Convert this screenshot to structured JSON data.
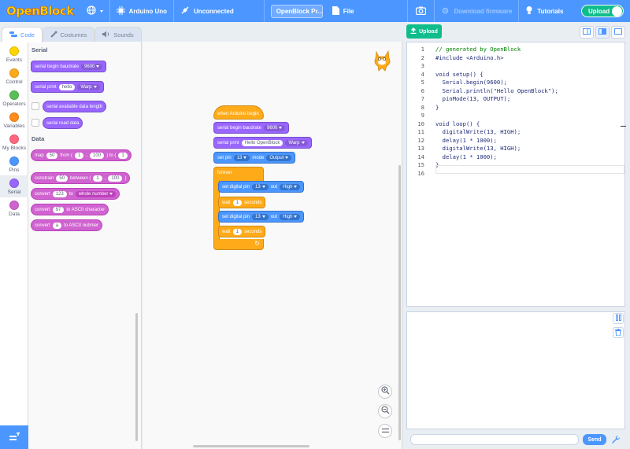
{
  "menubar": {
    "logo": "OpenBlock",
    "board": "Arduino Uno",
    "connection": "Unconnected",
    "project_name": "OpenBlock Pr...",
    "file": "File",
    "download_firmware": "Download firmware",
    "tutorials": "Tutorials",
    "mode_toggle": "Upload"
  },
  "tabs": {
    "code": "Code",
    "costumes": "Costumes",
    "sounds": "Sounds"
  },
  "categories": [
    {
      "label": "Events",
      "color": "#ffd500"
    },
    {
      "label": "Control",
      "color": "#ffab19"
    },
    {
      "label": "Operators",
      "color": "#59c059"
    },
    {
      "label": "Variables",
      "color": "#ff8c1a"
    },
    {
      "label": "My Blocks",
      "color": "#ff6680"
    },
    {
      "label": "Pins",
      "color": "#4c97ff"
    },
    {
      "label": "Serial",
      "color": "#9966ff"
    },
    {
      "label": "Data",
      "color": "#cf63cf"
    }
  ],
  "palette": {
    "serial_heading": "Serial",
    "begin": {
      "text": "serial begin baudrate",
      "value": "9600"
    },
    "print": {
      "text": "serial print",
      "value": "hello",
      "mode": "Warp"
    },
    "available": "serial available data length",
    "read": "serial read data",
    "data_heading": "Data",
    "map": {
      "text": "map",
      "v1": "50",
      "from": "from (",
      "v2": "1",
      "comma": ",",
      "v3": "100",
      "to": ") to (",
      "v4": "1"
    },
    "constrain": {
      "text": "constrain",
      "v1": "50",
      "between": "between (",
      "v2": "1",
      "comma": ",",
      "v3": "100",
      "close": ")"
    },
    "convert": {
      "text": "convert",
      "v1": "123",
      "to": "to",
      "type": "whole number"
    },
    "convert_char": {
      "text": "convert",
      "v1": "97",
      "suffix": "to ASCII character"
    },
    "convert_num": {
      "text": "convert",
      "v1": "a",
      "suffix": "to ASCII nubmer"
    }
  },
  "script": {
    "hat": "when Arduino begin",
    "begin": {
      "text": "serial begin baudrate",
      "value": "9600"
    },
    "print": {
      "text": "serial print",
      "value": "Hello OpenBlock",
      "mode": "Warp"
    },
    "setpin": {
      "text": "set pin",
      "pin": "13",
      "mode_label": "mode",
      "mode": "Output"
    },
    "forever": "forever",
    "dw1": {
      "text": "set digital pin",
      "pin": "13",
      "out": "out",
      "level": "High"
    },
    "wait1": {
      "text": "wait",
      "value": "1",
      "unit": "seconds"
    },
    "dw2": {
      "text": "set digital pin",
      "pin": "13",
      "out": "out",
      "level": "High"
    },
    "wait2": {
      "text": "wait",
      "value": "1",
      "unit": "seconds"
    }
  },
  "upload_button": "Upload",
  "code_lines": [
    {
      "n": "1",
      "t": "// generated by OpenBlock"
    },
    {
      "n": "2",
      "t": "#include <Arduino.h>"
    },
    {
      "n": "3",
      "t": ""
    },
    {
      "n": "4",
      "t": "void setup() {"
    },
    {
      "n": "5",
      "t": "  Serial.begin(9600);"
    },
    {
      "n": "6",
      "t": "  Serial.println(\"Hello OpenBlock\");"
    },
    {
      "n": "7",
      "t": "  pinMode(13, OUTPUT);"
    },
    {
      "n": "8",
      "t": "}"
    },
    {
      "n": "9",
      "t": ""
    },
    {
      "n": "10",
      "t": "void loop() {"
    },
    {
      "n": "11",
      "t": "  digitalWrite(13, HIGH);"
    },
    {
      "n": "12",
      "t": "  delay(1 * 1000);"
    },
    {
      "n": "13",
      "t": "  digitalWrite(13, HIGH);"
    },
    {
      "n": "14",
      "t": "  delay(1 * 1000);"
    },
    {
      "n": "15",
      "t": "}"
    },
    {
      "n": "16",
      "t": ""
    }
  ],
  "serial_monitor": {
    "input_value": "",
    "send": "Send"
  }
}
